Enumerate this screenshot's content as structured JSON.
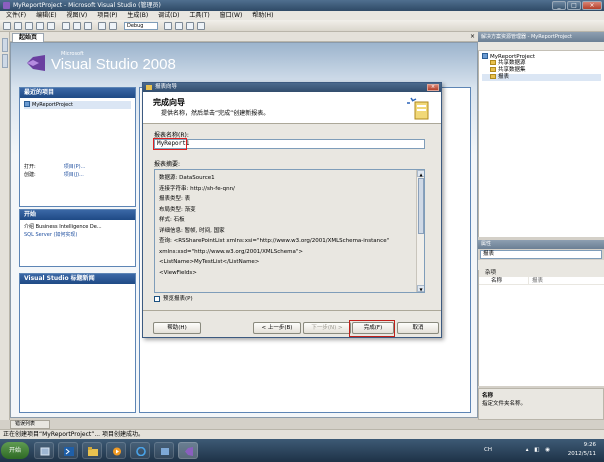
{
  "window": {
    "title": "MyReportProject - Microsoft Visual Studio (管理员)",
    "controls": {
      "minimize": "_",
      "maximize": "□",
      "close": "×"
    }
  },
  "menubar": [
    "文件(F)",
    "编辑(E)",
    "视图(V)",
    "项目(P)",
    "生成(B)",
    "调试(D)",
    "工具(T)",
    "窗口(W)",
    "帮助(H)"
  ],
  "toolbar": {
    "config": "Debug"
  },
  "document_tab": {
    "label": "起始页",
    "close": "×"
  },
  "start_page": {
    "logo": {
      "ms": "Microsoft",
      "product": "Visual Studio",
      "version": "2008"
    },
    "recent": {
      "title": "最近的项目",
      "items": [
        "MyReportProject"
      ],
      "open_label": "打开:",
      "open_link": "项目(P)...",
      "create_label": "创建:",
      "create_link": "项目(J)..."
    },
    "getting_started": {
      "title": "开始",
      "items": [
        "介绍 Business Intelligence De...",
        "SQL Server (如何实现)"
      ]
    },
    "headlines": {
      "title": "Visual Studio 标题新闻"
    }
  },
  "dialog": {
    "title": "报表向导",
    "heading": "完成向导",
    "subheading": "提供名称，然后单击“完成”创建新报表。",
    "name_label": "报表名称(R):",
    "name_value": "MyReport1",
    "summary_label": "报表摘要:",
    "summary_lines": [
      "数据源:  DataSource1",
      "连接字符串:  http://sh-fe-qnn/",
      "报表类型:  表",
      "布局类型:  渐变",
      "样式:  石板",
      "详细信息:  暂帧, 时间, 国家",
      "查询:  <RSSharePointList xmlns:xsi=\"http://www.w3.org/2001/XMLSchema-instance\"",
      "xmlns:xsd=\"http://www.w3.org/2001/XMLSchema\">",
      "  <ListName>MyTestList</ListName>",
      "  <ViewFields>"
    ],
    "preview_label": "预览报表(P)",
    "buttons": {
      "help": "帮助(H)",
      "back": "< 上一步(B)",
      "next": "下一步(N) >",
      "finish": "完成(F)",
      "cancel": "取消"
    }
  },
  "solution_explorer": {
    "title": "解决方案资源管理器 - MyReportProject",
    "project": "MyReportProject",
    "folders": [
      "共享数据源",
      "共享数据集",
      "报表"
    ]
  },
  "properties": {
    "title": "属性",
    "selected": "报表",
    "category": "杂项",
    "rows": [
      {
        "key": "名称",
        "value": "报表"
      }
    ],
    "desc_title": "名称",
    "desc_text": "指定文件夹名称。"
  },
  "error_tab": "错误列表",
  "status": "正在创建项目“MyReportProject”... 项目创建成功。",
  "taskbar": {
    "start": "开始",
    "lang": "CH",
    "time": "9:26",
    "date": "2012/5/11"
  },
  "colors": {
    "accent": "#1f4a85",
    "highlight_red": "#c0201a"
  }
}
